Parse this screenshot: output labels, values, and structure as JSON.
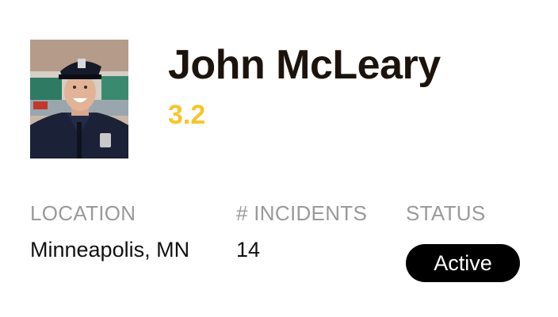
{
  "profile": {
    "name": "John McLeary",
    "rating": "3.2",
    "photo_alt": "officer-photo"
  },
  "fields": {
    "location": {
      "label": "LOCATION",
      "value": "Minneapolis, MN"
    },
    "incidents": {
      "label": "# INCIDENTS",
      "value": "14"
    },
    "status": {
      "label": "STATUS",
      "value": "Active"
    }
  },
  "colors": {
    "name": "#1c140c",
    "rating": "#f7c52a",
    "label": "#9a9a9a",
    "badge_bg": "#000000",
    "badge_text": "#ffffff"
  }
}
